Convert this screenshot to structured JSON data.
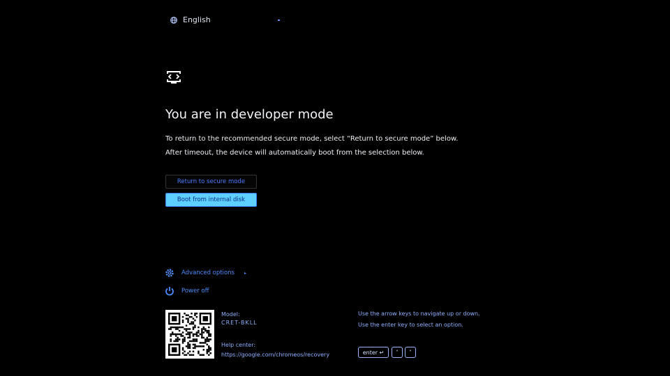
{
  "language": {
    "label": "English",
    "icon": "globe-icon"
  },
  "title": "You are in developer mode",
  "description": [
    "To return to the recommended secure mode, select “Return to secure mode” below.",
    "After timeout, the device will automatically boot from the selection below."
  ],
  "buttons": {
    "secure": "Return to secure mode",
    "boot": "Boot from internal disk"
  },
  "options": {
    "advanced": "Advanced options",
    "power": "Power off"
  },
  "footer": {
    "model_label": "Model:",
    "model_value": "CRET-BKLL",
    "help_label": "Help center:",
    "help_url": "https://google.com/chromeos/recovery",
    "hint1": "Use the arrow keys to navigate up or down.",
    "hint2": "Use the enter key to select an option.",
    "enter_key": "enter ↵",
    "up_key": "˄",
    "down_key": "˅"
  },
  "colors": {
    "accent": "#4a7dff",
    "highlight": "#5ed0ff"
  }
}
